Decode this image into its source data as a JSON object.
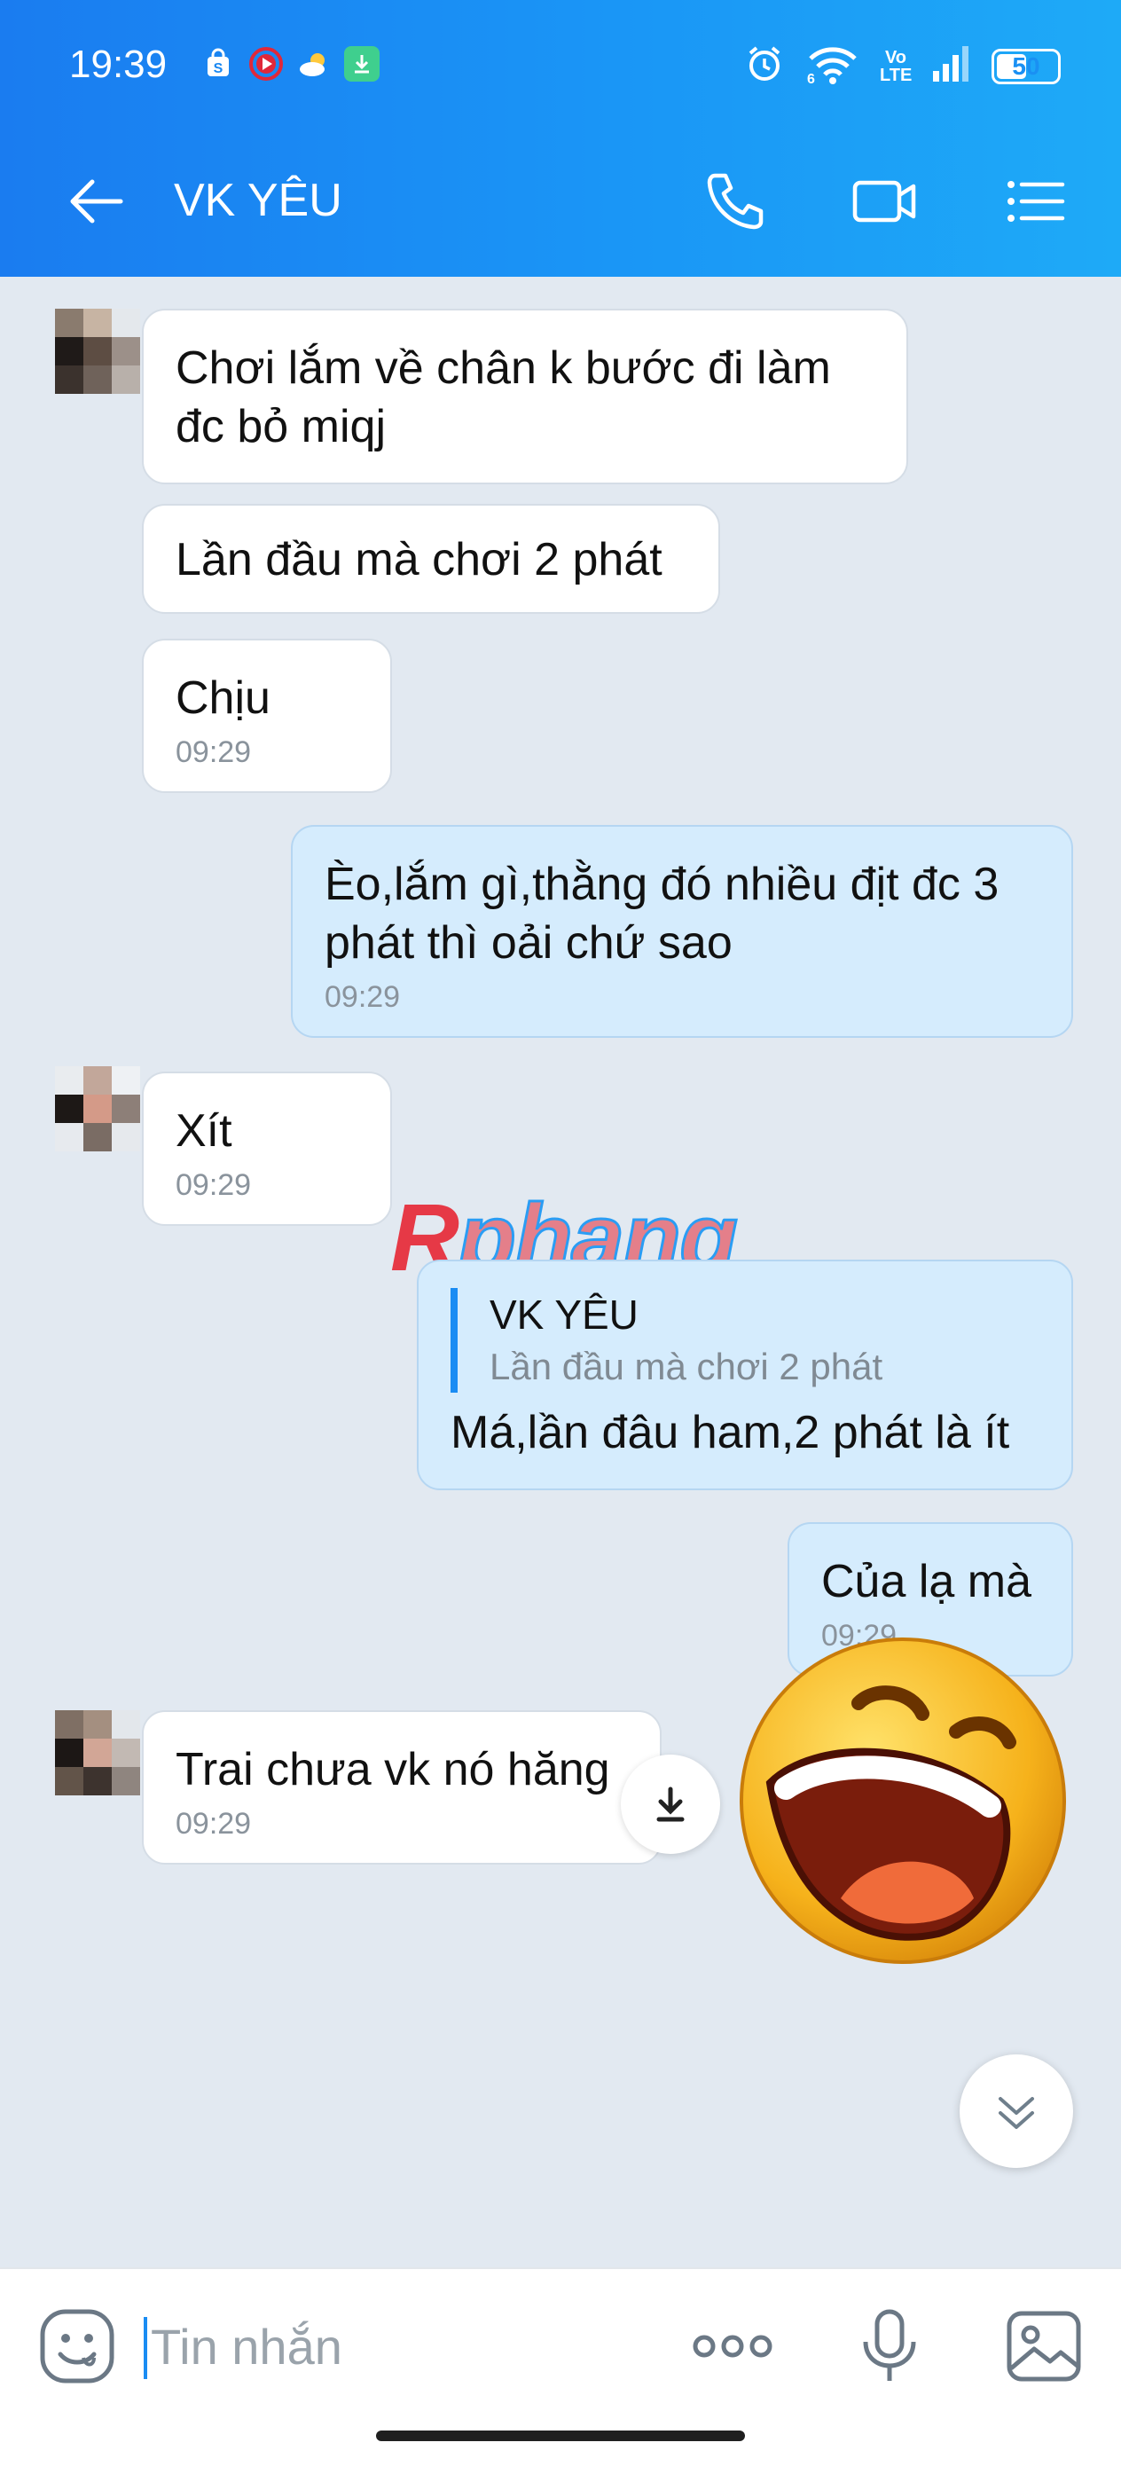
{
  "status_bar": {
    "time": "19:39",
    "network_label": "Vo LTE",
    "battery_level": "50",
    "battery_fraction": 0.5,
    "icons": [
      "shop-icon",
      "record-icon",
      "weather-icon",
      "download-status-icon",
      "alarm-icon",
      "wifi-icon",
      "volte-icon",
      "signal-icon",
      "battery-icon"
    ]
  },
  "header": {
    "title": "VK YÊU",
    "icons": [
      "back-arrow-icon",
      "phone-icon",
      "video-call-icon",
      "menu-list-icon"
    ]
  },
  "messages": [
    {
      "direction": "in",
      "text": "Chơi lắm về chân k bước đi làm đc bỏ miqj",
      "time": ""
    },
    {
      "direction": "in",
      "text": "Lần đầu mà chơi 2 phát",
      "time": ""
    },
    {
      "direction": "in",
      "text": "Chịu",
      "time": "09:29"
    },
    {
      "direction": "out",
      "text": "Èo,lắm gì,thằng đó nhiều địt đc 3 phát thì oải chứ sao",
      "time": "09:29"
    },
    {
      "direction": "in",
      "text": "Xít",
      "time": "09:29"
    },
    {
      "direction": "out",
      "reply_name": "VK YÊU",
      "reply_text": "Lần đầu mà chơi 2 phát",
      "text": "Má,lần đâu ham,2 phát là ít",
      "time": ""
    },
    {
      "direction": "out",
      "text": "Của lạ mà",
      "time": "09:29"
    },
    {
      "direction": "in",
      "text": "Trai chưa vk nó hăng",
      "time": "09:29"
    }
  ],
  "watermark": {
    "part1": "R",
    "part2": "phang"
  },
  "input": {
    "placeholder": "Tin nhắn",
    "icons": [
      "emoji-icon",
      "more-icon",
      "microphone-icon",
      "image-icon"
    ]
  },
  "colors": {
    "header_start": "#1a7cf0",
    "header_end": "#1eaaf7",
    "chat_bg": "#e2e9f1",
    "incoming_bubble": "#ffffff",
    "outgoing_bubble": "#d5ecfd",
    "accent": "#1a8cf3"
  }
}
